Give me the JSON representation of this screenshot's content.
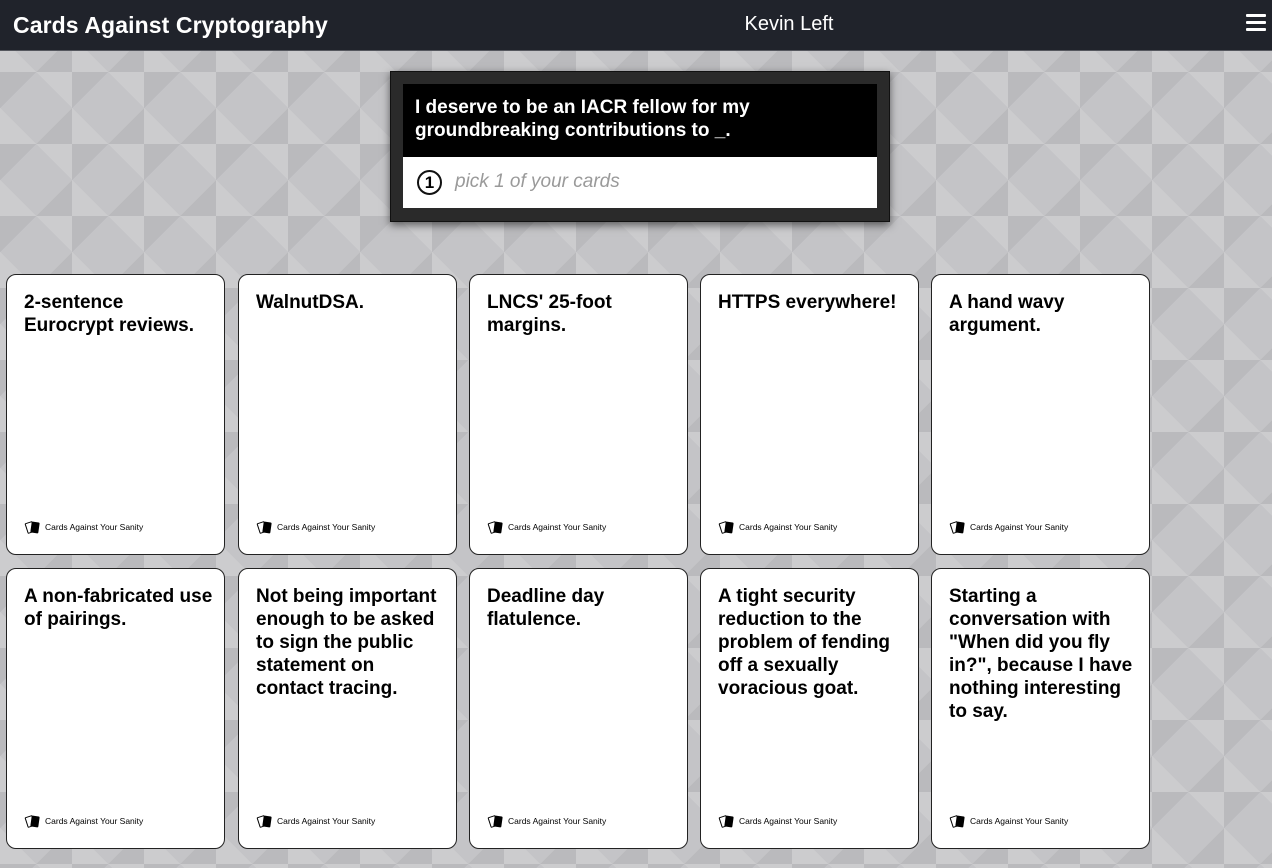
{
  "header": {
    "app_title": "Cards Against Cryptography",
    "player_name": "Kevin Left",
    "menu_icon": "hamburger-menu-icon"
  },
  "prompt": {
    "text": "I deserve to be an IACR fellow for my groundbreaking contributions to _.",
    "pick_count": "1",
    "pick_instruction": "pick 1 of your cards"
  },
  "cards": [
    {
      "text": "2-sentence Eurocrypt reviews.",
      "brand": "Cards Against Your Sanity"
    },
    {
      "text": "WalnutDSA.",
      "brand": "Cards Against Your Sanity"
    },
    {
      "text": "LNCS' 25-foot margins.",
      "brand": "Cards Against Your Sanity"
    },
    {
      "text": "HTTPS everywhere!",
      "brand": "Cards Against Your Sanity"
    },
    {
      "text": "A hand wavy argument.",
      "brand": "Cards Against Your Sanity"
    },
    {
      "text": "A non-fabricated use of pairings.",
      "brand": "Cards Against Your Sanity"
    },
    {
      "text": "Not being important enough to be asked to sign the public statement on contact tracing.",
      "brand": "Cards Against Your Sanity"
    },
    {
      "text": "Deadline day flatulence.",
      "brand": "Cards Against Your Sanity"
    },
    {
      "text": "A tight security reduction to the problem of fending off a sexually voracious goat.",
      "brand": "Cards Against Your Sanity"
    },
    {
      "text": "Starting a conversation with \"When did you fly in?\", because I have nothing interesting to say.",
      "brand": "Cards Against Your Sanity"
    }
  ]
}
